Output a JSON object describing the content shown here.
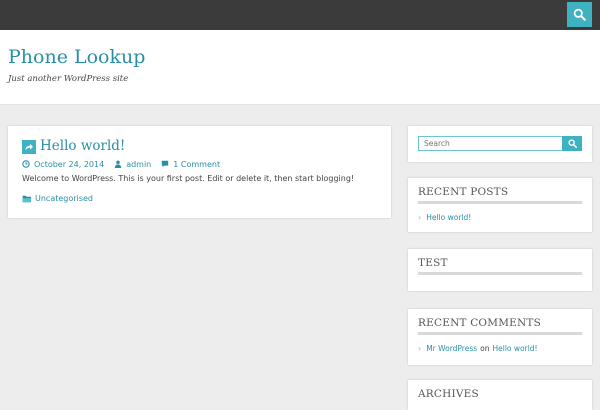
{
  "site": {
    "title": "Phone Lookup",
    "description": "Just another WordPress site"
  },
  "post": {
    "title": "Hello world!",
    "date": "October 24, 2014",
    "author": "admin",
    "comments": "1 Comment",
    "excerpt": "Welcome to WordPress. This is your first post. Edit or delete it, then start blogging!",
    "category": "Uncategorised"
  },
  "sidebar": {
    "search_placeholder": "Search",
    "recent_posts": {
      "title": "RECENT POSTS",
      "items": [
        "Hello world!"
      ]
    },
    "test": {
      "title": "TEST"
    },
    "recent_comments": {
      "title": "RECENT COMMENTS",
      "items": [
        {
          "author": "Mr WordPress",
          "connector": "on",
          "post": "Hello world!"
        }
      ]
    },
    "archives": {
      "title": "ARCHIVES"
    }
  },
  "colors": {
    "accent": "#3eb2c1",
    "link": "#2a8fa6",
    "topbar": "#3b3b3b",
    "background": "#ededed"
  },
  "icons": {
    "top_search": "search-icon",
    "post_format": "share-arrow-icon",
    "date": "clock-icon",
    "author": "user-icon",
    "comments": "comment-icon",
    "category": "folder-icon",
    "list_bullet": "chevron-right-icon"
  }
}
